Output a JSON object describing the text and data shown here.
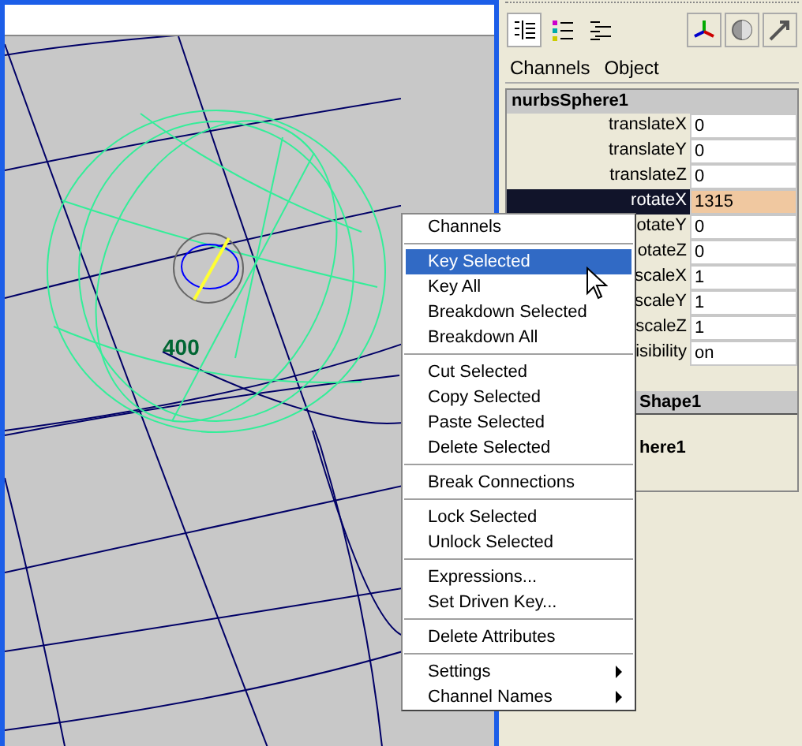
{
  "viewport": {
    "label": "400"
  },
  "channel_box": {
    "menu": [
      "Channels",
      "Object"
    ],
    "object": "nurbsSphere1",
    "channels": [
      {
        "name": "translateX",
        "value": "0",
        "selected": false
      },
      {
        "name": "translateY",
        "value": "0",
        "selected": false
      },
      {
        "name": "translateZ",
        "value": "0",
        "selected": false
      },
      {
        "name": "rotateX",
        "value": "1315",
        "selected": true
      },
      {
        "name": "otateY",
        "value": "0",
        "selected": false
      },
      {
        "name": "otateZ",
        "value": "0",
        "selected": false
      },
      {
        "name": "scaleX",
        "value": "1",
        "selected": false
      },
      {
        "name": "scaleY",
        "value": "1",
        "selected": false
      },
      {
        "name": "scaleZ",
        "value": "1",
        "selected": false
      },
      {
        "name": "isibility",
        "value": "on",
        "selected": false
      }
    ],
    "shape": "Shape1",
    "input": "here1"
  },
  "context_menu": {
    "groups": [
      [
        {
          "label": "Channels",
          "selected": false,
          "submenu": false
        }
      ],
      [
        {
          "label": "Key Selected",
          "selected": true,
          "submenu": false
        },
        {
          "label": "Key All",
          "selected": false,
          "submenu": false
        },
        {
          "label": "Breakdown Selected",
          "selected": false,
          "submenu": false
        },
        {
          "label": "Breakdown All",
          "selected": false,
          "submenu": false
        }
      ],
      [
        {
          "label": "Cut Selected",
          "selected": false,
          "submenu": false
        },
        {
          "label": "Copy Selected",
          "selected": false,
          "submenu": false
        },
        {
          "label": "Paste Selected",
          "selected": false,
          "submenu": false
        },
        {
          "label": "Delete Selected",
          "selected": false,
          "submenu": false
        }
      ],
      [
        {
          "label": "Break Connections",
          "selected": false,
          "submenu": false
        }
      ],
      [
        {
          "label": "Lock Selected",
          "selected": false,
          "submenu": false
        },
        {
          "label": "Unlock Selected",
          "selected": false,
          "submenu": false
        }
      ],
      [
        {
          "label": "Expressions...",
          "selected": false,
          "submenu": false
        },
        {
          "label": "Set Driven Key...",
          "selected": false,
          "submenu": false
        }
      ],
      [
        {
          "label": "Delete Attributes",
          "selected": false,
          "submenu": false
        }
      ],
      [
        {
          "label": "Settings",
          "selected": false,
          "submenu": true
        },
        {
          "label": "Channel Names",
          "selected": false,
          "submenu": true
        }
      ]
    ]
  }
}
